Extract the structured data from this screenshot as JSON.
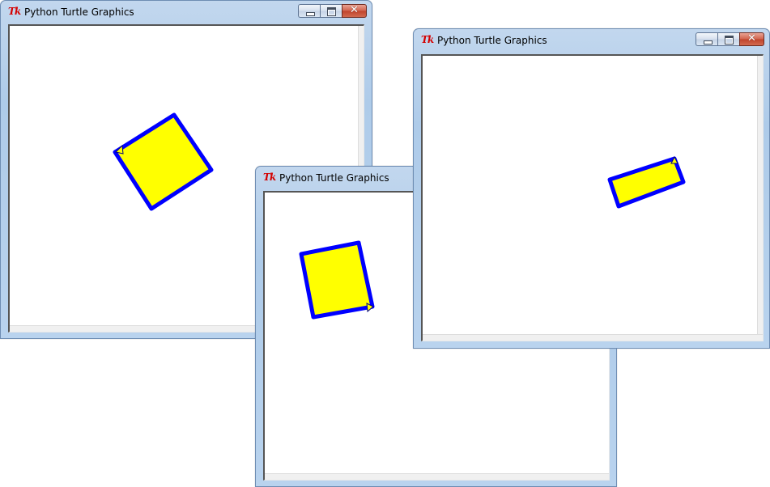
{
  "windows": [
    {
      "id": "turtle-window-1",
      "title": "Python Turtle Graphics",
      "logo": "Tk",
      "shape": "rotated-square",
      "fill_color": "#ffff00",
      "stroke_color": "#0000ff"
    },
    {
      "id": "turtle-window-2",
      "title": "Python Turtle Graphics",
      "logo": "Tk",
      "shape": "tilted-rectangle",
      "fill_color": "#ffff00",
      "stroke_color": "#0000ff"
    },
    {
      "id": "turtle-window-3",
      "title": "Python Turtle Graphics",
      "logo": "Tk",
      "shape": "flat-rectangle",
      "fill_color": "#ffff00",
      "stroke_color": "#0000ff"
    }
  ],
  "caption_buttons": {
    "minimize_icon": "minimize-icon",
    "maximize_icon": "maximize-icon",
    "close_icon": "close-icon",
    "close_glyph": "✕"
  }
}
